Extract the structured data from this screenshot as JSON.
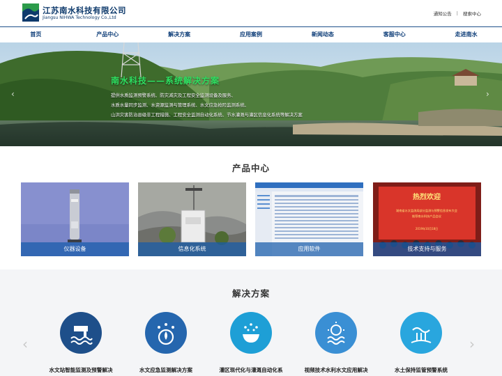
{
  "header": {
    "company_cn": "江苏南水科技有限公司",
    "company_en": "Jiangsu NIHWA Technology Co.,Ltd",
    "links": {
      "notice": "通知公告",
      "separator": "|",
      "search": "搜索中心"
    }
  },
  "nav": {
    "items": [
      {
        "label": "首页"
      },
      {
        "label": "产品中心"
      },
      {
        "label": "解决方案"
      },
      {
        "label": "应用案例"
      },
      {
        "label": "新闻动态"
      },
      {
        "label": "客服中心"
      },
      {
        "label": "走进南水"
      }
    ]
  },
  "banner": {
    "title": "南水科技——系统解决方案",
    "lines": [
      "提供水质监测预警系统、防灾减灾及工程安全监测设备及服务、",
      "水质水量同步监测、水资源监测与管理系统、水文应急抢险监测系统、",
      "山洪灾害防治县级非工程措施、工程安全监测自动化系统、节水灌溉与灌区信息化系统等解决方案"
    ],
    "prev_arrow": "‹",
    "next_arrow": "›",
    "sign_text": "热烈欢迎",
    "sign_sub1": "湖南省水文监测局部分监测与预警信息发布大会",
    "sign_sub2": "推荐南水科技产品会议",
    "sign_date": "2019年10月18日"
  },
  "products": {
    "title": "产品中心",
    "items": [
      {
        "label": "仪器设备"
      },
      {
        "label": "信息化系统"
      },
      {
        "label": "应用软件"
      },
      {
        "label": "技术支持与服务"
      }
    ]
  },
  "solutions": {
    "title": "解决方案",
    "prev_arrow": "‹",
    "next_arrow": "›",
    "items": [
      {
        "label": "水文站智能监测及预警解决",
        "icon": "hydrology-station-icon",
        "color": "#1e4f8a"
      },
      {
        "label": "水文应急监测解决方案",
        "icon": "water-drop-icon",
        "color": "#2566ae"
      },
      {
        "label": "灌区现代化与灌溉自动化系",
        "icon": "irrigation-icon",
        "color": "#1e9fd6"
      },
      {
        "label": "视频技术水利水文应用解决",
        "icon": "video-water-icon",
        "color": "#3a8fd4"
      },
      {
        "label": "水土保持监管预警系统",
        "icon": "soil-conservation-icon",
        "color": "#29a6de"
      }
    ]
  },
  "colors": {
    "brand": "#0e3a6c",
    "banner_title": "#2ee061",
    "label_bar": "#185caa"
  }
}
